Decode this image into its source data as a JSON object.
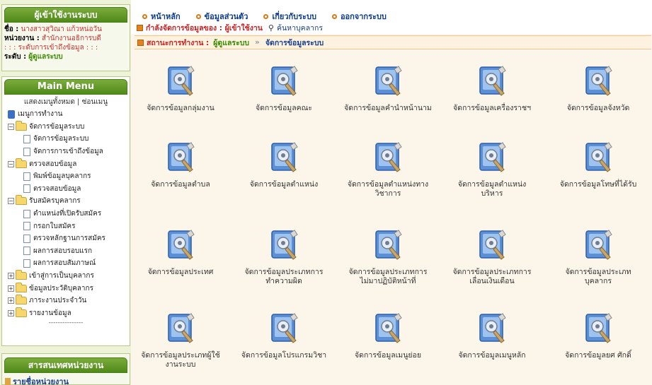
{
  "user": {
    "title": "ผู้เข้าใช้งานระบบ",
    "name_label": "ชื่อ :",
    "name_value": "นางสาวสุวิณา แก้วหน่อวัน",
    "unit_label": "หน่วยงาน :",
    "unit_value": "สำนักงานอธิการบดี",
    "access_line": ": : : ระดับการเข้าถึงข้อมูล : : :",
    "level_label": "ระดับ :",
    "level_value": "ผู้ดูแลระบบ"
  },
  "menu": {
    "title": "Main Menu",
    "show_all": "แสดงเมนูทั้งหมด",
    "separator": "|",
    "hide": "ซ่อนเมนู",
    "root": "เมนูการทำงาน",
    "groups": [
      {
        "label": "จัดการข้อมูลระบบ",
        "sign": "−",
        "items": [
          "จัดการข้อมูลระบบ",
          "จัดการการเข้าถึงข้อมูล"
        ]
      },
      {
        "label": "ตรวจสอบข้อมูล",
        "sign": "−",
        "items": [
          "พิมพ์ข้อมูลบุคลากร",
          "ตรวจสอบข้อมูล"
        ]
      },
      {
        "label": "รับสมัครบุคลากร",
        "sign": "−",
        "items": [
          "ตำแหน่งที่เปิดรับสมัคร",
          "กรอกใบสมัคร",
          "ตรวจหลักฐานการสมัคร",
          "ผลการสอบรอบแรก",
          "ผลการสอบสัมภาษณ์"
        ]
      },
      {
        "label": "เข้าสู่การเป็นบุคลากร",
        "sign": "+",
        "items": []
      },
      {
        "label": "ข้อมูลประวัติบุคลากร",
        "sign": "+",
        "items": []
      },
      {
        "label": "ภาระงานประจำวัน",
        "sign": "+",
        "items": []
      },
      {
        "label": "รายงานข้อมูล",
        "sign": "+",
        "items": []
      }
    ],
    "dashes": "---------------"
  },
  "org": {
    "title": "สารสนเทศหน่วยงาน",
    "link": "รายชื่อหน่วยงาน"
  },
  "nav": {
    "items": [
      "หน้าหลัก",
      "ข้อมูลส่วนตัว",
      "เกี่ยวกับระบบ",
      "ออกจากระบบ"
    ],
    "managing_label": "กำลังจัดการข้อมูลของ : ผู้เข้าใช้งาน",
    "search_link": "ค้นหาบุคลากร",
    "status_label": "สถานะการทำงาน :",
    "status_role": "ผู้ดูแลระบบ",
    "status_arrow": "»",
    "status_page": "จัดการข้อมูลระบบ"
  },
  "tiles": [
    [
      "จัดการข้อมูลกลุ่มงาน"
    ],
    [
      "จัดการข้อมูลคณะ"
    ],
    [
      "จัดการข้อมูลคำนำหน้านาม"
    ],
    [
      "จัดการข้อมูลเครื่องราชฯ"
    ],
    [
      "จัดการข้อมูลจังหวัด"
    ],
    [
      "จัดการข้อมูลตำบล"
    ],
    [
      "จัดการข้อมูลตำแหน่ง"
    ],
    [
      "จัดการข้อมูลตำแหน่งทาง",
      "วิชาการ"
    ],
    [
      "จัดการข้อมูลตำแหน่ง",
      "บริหาร"
    ],
    [
      "จัดการข้อมูลโทษที่ได้รับ"
    ],
    [
      "จัดการข้อมูลประเทศ"
    ],
    [
      "จัดการข้อมูลประเภทการ",
      "ทำความผิด"
    ],
    [
      "จัดการข้อมูลประเภทการ",
      "ไม่มาปฏิบัติหน้าที่"
    ],
    [
      "จัดการข้อมูลประเภทการ",
      "เลื่อนเงินเดือน"
    ],
    [
      "จัดการข้อมูลประเภท",
      "บุคลากร"
    ],
    [
      "จัดการข้อมูลประเภทผู้ใช้",
      "งานระบบ"
    ],
    [
      "จัดการข้อมูลโปรแกรมวิชา"
    ],
    [
      "จัดการข้อมูลเมนูย่อย"
    ],
    [
      "จัดการข้อมูลเมนูหลัก"
    ],
    [
      "จัดการข้อมูลยศ ศักดิ์"
    ]
  ],
  "colors": {
    "panel_green": "#5d9624",
    "nav_blue": "#0b3a8a",
    "accent_red": "#c82323",
    "accent_green": "#3a8a00",
    "main_bg": "#fbf5ea"
  }
}
